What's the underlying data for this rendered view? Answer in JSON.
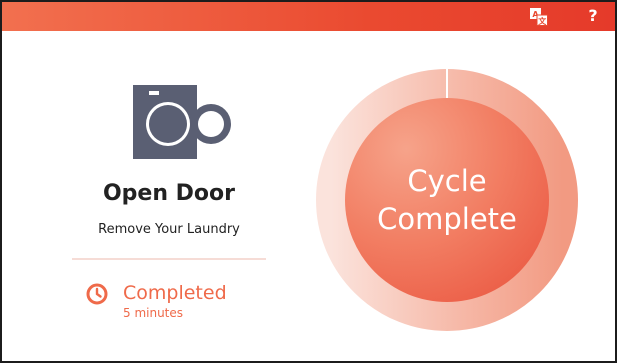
{
  "header": {
    "translate_icon": "translate-icon",
    "help_label": "?",
    "accent_color": "#e84a31"
  },
  "status": {
    "appliance_icon": "front-load-washer-icon",
    "title": "Open Door",
    "subtitle": "Remove Your Laundry"
  },
  "completion": {
    "icon": "clock-icon",
    "label": "Completed",
    "time": "5 minutes"
  },
  "cycle": {
    "line1": "Cycle",
    "line2": "Complete",
    "progress_fraction": 1.0
  },
  "colors": {
    "primary": "#ee6446",
    "ring_light": "#f7c9bc",
    "icon_gray": "#5a5f73"
  }
}
